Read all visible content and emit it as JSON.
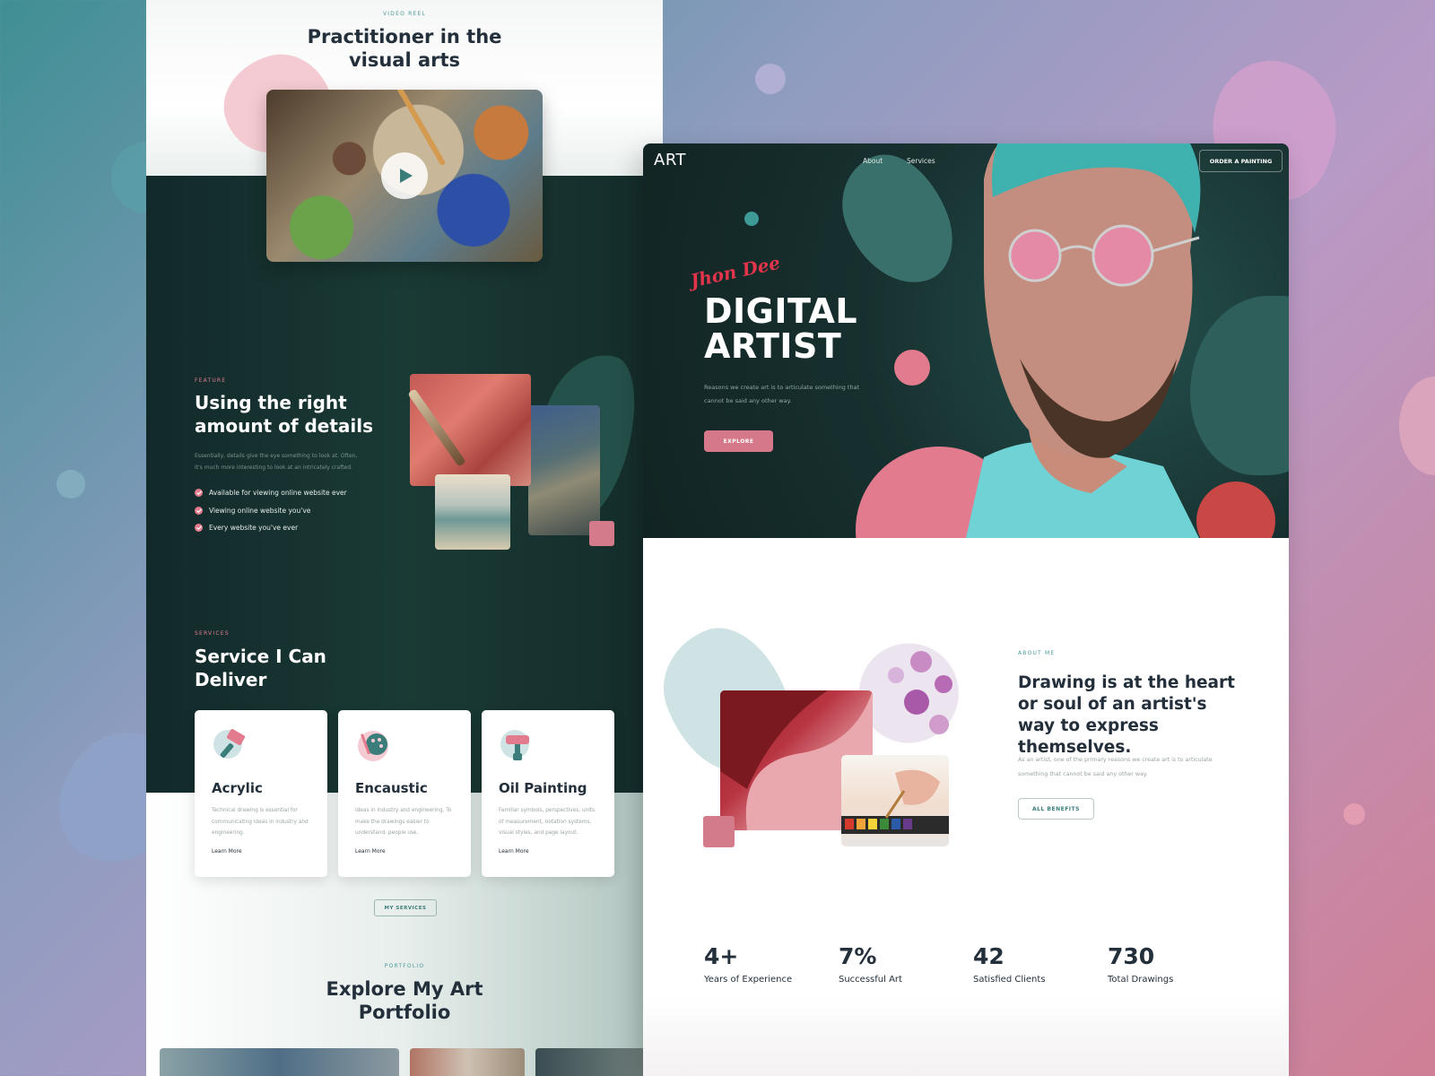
{
  "colors": {
    "accent_pink": "#e27b8e",
    "dark_green": "#17302f",
    "teal": "#4a9a9a",
    "red": "#c94846"
  },
  "left_page": {
    "video_reel": {
      "eyebrow": "VIDEO REEL",
      "title_line1": "Practitioner in the",
      "title_line2": "visual arts",
      "play_icon": "play-icon"
    },
    "feature": {
      "eyebrow": "FEATURE",
      "title_line1": "Using the right",
      "title_line2": "amount of details",
      "description": "Essentially, details give the eye something to look at. Often, it's much more interesting to look at an intricately crafted.",
      "items": [
        "Available for viewing online website ever",
        "Viewing online website you've",
        "Every website you've ever"
      ]
    },
    "services": {
      "eyebrow": "SERVICES",
      "title_line1": "Service I Can",
      "title_line2": "Deliver",
      "cards": [
        {
          "name": "Acrylic",
          "description": "Technical drawing is essential for communicating ideas in industry and engineering.",
          "link": "Learn More",
          "icon": "paint-roller-icon"
        },
        {
          "name": "Encaustic",
          "description": "Ideas in industry and engineering. To make the drawings easier to understand, people use.",
          "link": "Learn More",
          "icon": "palette-icon"
        },
        {
          "name": "Oil Painting",
          "description": "Familiar symbols, perspectives, units of measurement, notation systems, visual styles, and page layout.",
          "link": "Learn More",
          "icon": "paint-bucket-icon"
        }
      ],
      "button": "MY SERVICES"
    },
    "portfolio": {
      "eyebrow": "PORTFOLIO",
      "title_line1": "Explore My Art",
      "title_line2": "Portfolio"
    }
  },
  "right_page": {
    "nav": {
      "logo": "ART",
      "items": [
        "About",
        "Services"
      ],
      "cta": "ORDER A PAINTING"
    },
    "hero": {
      "script_name": "Jhon Dee",
      "title_line1": "DIGITAL",
      "title_line2": "ARTIST",
      "description": "Reasons we create art is to articulate something that cannot be said any other way.",
      "button": "EXPLORE"
    },
    "about": {
      "eyebrow": "ABOUT ME",
      "title": "Drawing is at the heart or soul of an artist's way to express themselves.",
      "description": "As an artist, one of the primary reasons we create art is to articulate something that cannot be said any other way.",
      "button": "ALL BENEFITS"
    },
    "stats": [
      {
        "value": "4+",
        "label": "Years of Experience"
      },
      {
        "value": "7%",
        "label": "Successful Art"
      },
      {
        "value": "42",
        "label": "Satisfied Clients"
      },
      {
        "value": "730",
        "label": "Total Drawings"
      }
    ]
  }
}
